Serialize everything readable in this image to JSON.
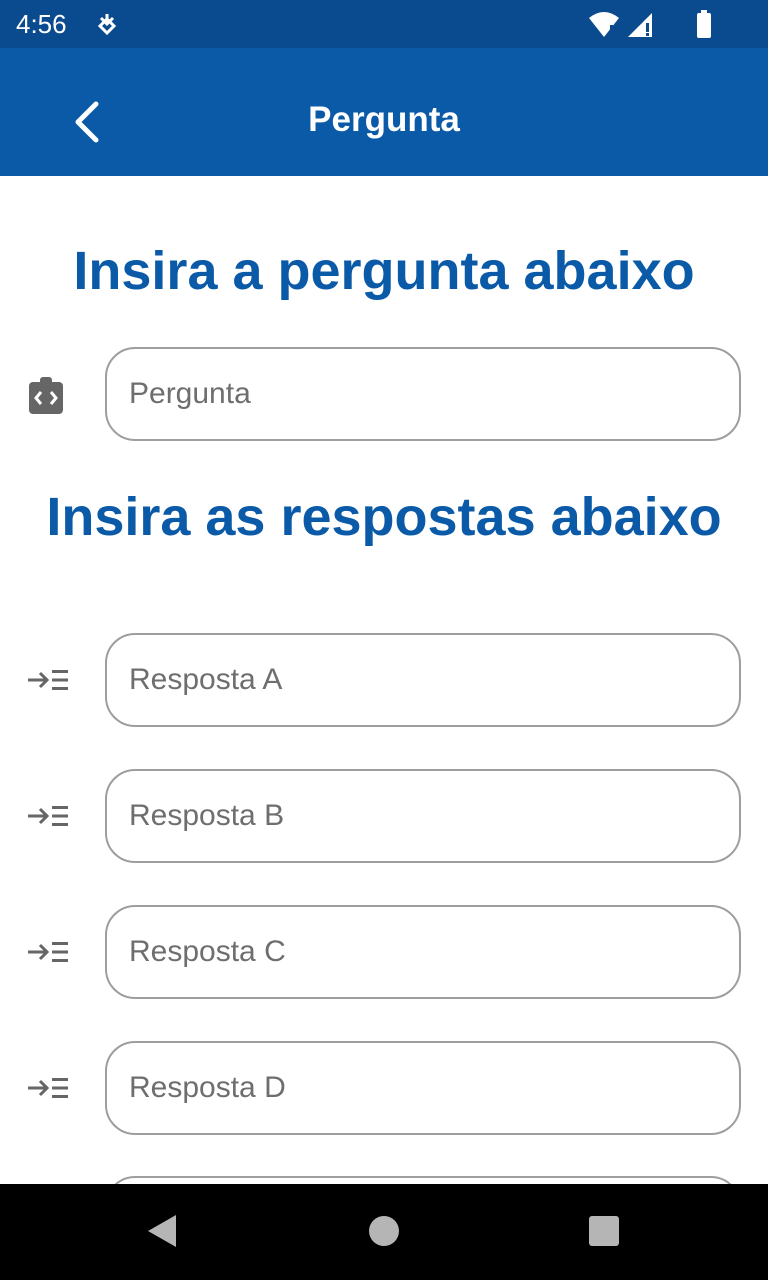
{
  "status_bar": {
    "time": "4:56",
    "notification_icon": "data-saver-icon",
    "wifi_icon": "wifi-icon",
    "signal_icon": "signal-icon",
    "battery_icon": "battery-icon"
  },
  "app_bar": {
    "title": "Pergunta",
    "back_icon": "back-arrow-icon",
    "background_color": "#0a5aa8"
  },
  "question_section": {
    "heading": "Insira a pergunta abaixo",
    "icon": "code-clipboard-icon",
    "input": {
      "placeholder": "Pergunta",
      "value": ""
    }
  },
  "answers_section": {
    "heading": "Insira as respostas abaixo",
    "icon": "list-input-icon",
    "inputs": [
      {
        "placeholder": "Resposta A",
        "value": ""
      },
      {
        "placeholder": "Resposta B",
        "value": ""
      },
      {
        "placeholder": "Resposta C",
        "value": ""
      },
      {
        "placeholder": "Resposta D",
        "value": ""
      }
    ]
  },
  "nav_bar": {
    "back": "nav-back-icon",
    "home": "nav-home-icon",
    "recents": "nav-recents-icon"
  },
  "colors": {
    "accent": "#0a5aa8",
    "status_bar": "#0a4a8e",
    "field_border": "#9e9e9e",
    "icon_gray": "#666666"
  }
}
